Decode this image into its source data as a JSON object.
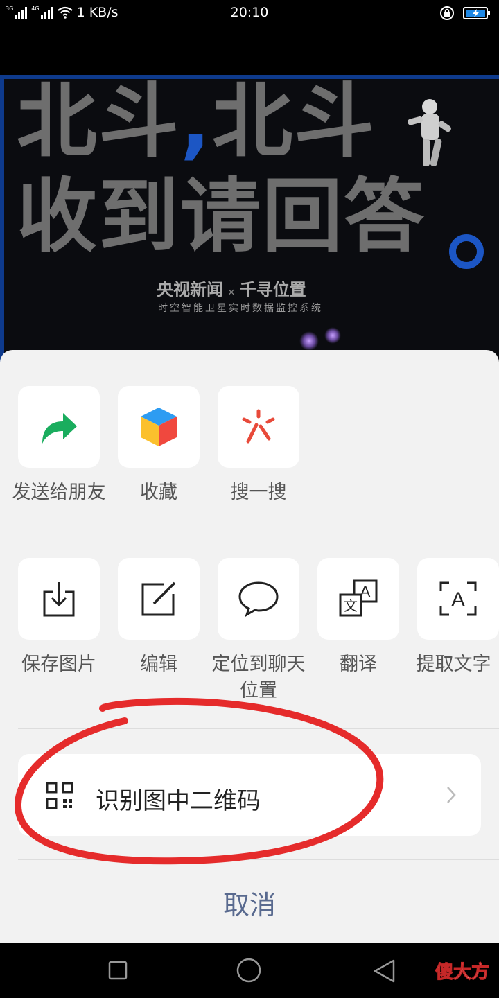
{
  "status_bar": {
    "network_3g": "3G",
    "network_4g": "4G",
    "speed": "1 KB/s",
    "time": "20:10"
  },
  "poster": {
    "line1_a": "北斗",
    "line1_comma": ",",
    "line1_b": "北斗",
    "line2": "收到请回答",
    "brand_cctv": "央视新闻",
    "brand_sep": "×",
    "brand_qx": "千寻位置",
    "tagline": "时空智能卫星实时数据监控系统",
    "accent_color": "#1c56c4"
  },
  "share_row": [
    {
      "label": "发送给朋友",
      "icon": "share-arrow-icon"
    },
    {
      "label": "收藏",
      "icon": "favorite-cube-icon"
    },
    {
      "label": "搜一搜",
      "icon": "search-spark-icon"
    }
  ],
  "action_row": [
    {
      "label": "保存图片",
      "icon": "download-icon"
    },
    {
      "label": "编辑",
      "icon": "edit-icon"
    },
    {
      "label": "定位到聊天位置",
      "icon": "chat-bubble-icon"
    },
    {
      "label": "翻译",
      "icon": "translate-icon"
    },
    {
      "label": "提取文字",
      "icon": "text-extract-icon"
    }
  ],
  "qr_action": {
    "label": "识别图中二维码",
    "icon": "qr-code-icon"
  },
  "cancel_label": "取消",
  "watermark": "傻大方"
}
